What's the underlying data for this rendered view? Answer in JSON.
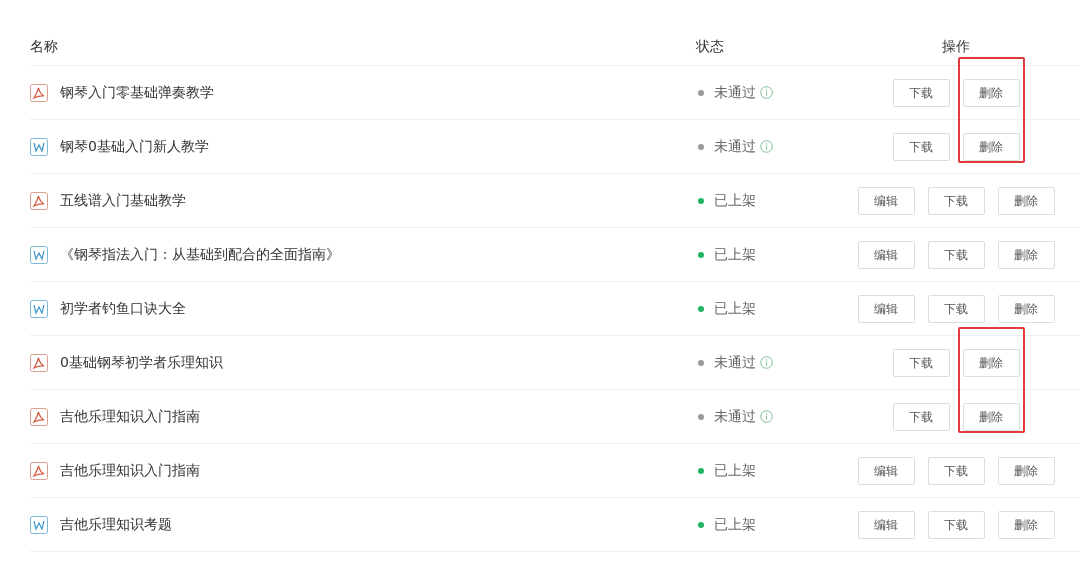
{
  "columns": [
    "名称",
    "状态",
    "操作"
  ],
  "rows": [
    {
      "kind": "pdf",
      "name": "钢琴入门零基础弹奏教学",
      "status": {
        "kind": "rejected",
        "label": "未通过"
      },
      "actions": [
        {
          "kind": "download",
          "label": "下载"
        },
        {
          "kind": "delete",
          "label": "删除"
        }
      ],
      "highlighted": true
    },
    {
      "kind": "word",
      "name": "钢琴0基础入门新人教学",
      "status": {
        "kind": "rejected",
        "label": "未通过"
      },
      "actions": [
        {
          "kind": "download",
          "label": "下载"
        },
        {
          "kind": "delete",
          "label": "删除"
        }
      ],
      "highlighted": true
    },
    {
      "kind": "pdf",
      "name": "五线谱入门基础教学",
      "status": {
        "kind": "listed",
        "label": "已上架"
      },
      "actions": [
        {
          "kind": "edit",
          "label": "编辑"
        },
        {
          "kind": "download",
          "label": "下载"
        },
        {
          "kind": "delete",
          "label": "删除"
        }
      ],
      "highlighted": false
    },
    {
      "kind": "word",
      "name": "《钢琴指法入门：从基础到配合的全面指南》",
      "status": {
        "kind": "listed",
        "label": "已上架"
      },
      "actions": [
        {
          "kind": "edit",
          "label": "编辑"
        },
        {
          "kind": "download",
          "label": "下载"
        },
        {
          "kind": "delete",
          "label": "删除"
        }
      ],
      "highlighted": false
    },
    {
      "kind": "word",
      "name": "初学者钓鱼口诀大全",
      "status": {
        "kind": "listed",
        "label": "已上架"
      },
      "actions": [
        {
          "kind": "edit",
          "label": "编辑"
        },
        {
          "kind": "download",
          "label": "下载"
        },
        {
          "kind": "delete",
          "label": "删除"
        }
      ],
      "highlighted": false
    },
    {
      "kind": "pdf",
      "name": "0基础钢琴初学者乐理知识",
      "status": {
        "kind": "rejected",
        "label": "未通过"
      },
      "actions": [
        {
          "kind": "download",
          "label": "下载"
        },
        {
          "kind": "delete",
          "label": "删除"
        }
      ],
      "highlighted": true
    },
    {
      "kind": "pdf",
      "name": "吉他乐理知识入门指南",
      "status": {
        "kind": "rejected",
        "label": "未通过"
      },
      "actions": [
        {
          "kind": "download",
          "label": "下载"
        },
        {
          "kind": "delete",
          "label": "删除"
        }
      ],
      "highlighted": true
    },
    {
      "kind": "pdf",
      "name": "吉他乐理知识入门指南",
      "status": {
        "kind": "listed",
        "label": "已上架"
      },
      "actions": [
        {
          "kind": "edit",
          "label": "编辑"
        },
        {
          "kind": "download",
          "label": "下载"
        },
        {
          "kind": "delete",
          "label": "删除"
        }
      ],
      "highlighted": false
    },
    {
      "kind": "word",
      "name": "吉他乐理知识考题",
      "status": {
        "kind": "listed",
        "label": "已上架"
      },
      "actions": [
        {
          "kind": "edit",
          "label": "编辑"
        },
        {
          "kind": "download",
          "label": "下载"
        },
        {
          "kind": "delete",
          "label": "删除"
        }
      ],
      "highlighted": false
    }
  ]
}
